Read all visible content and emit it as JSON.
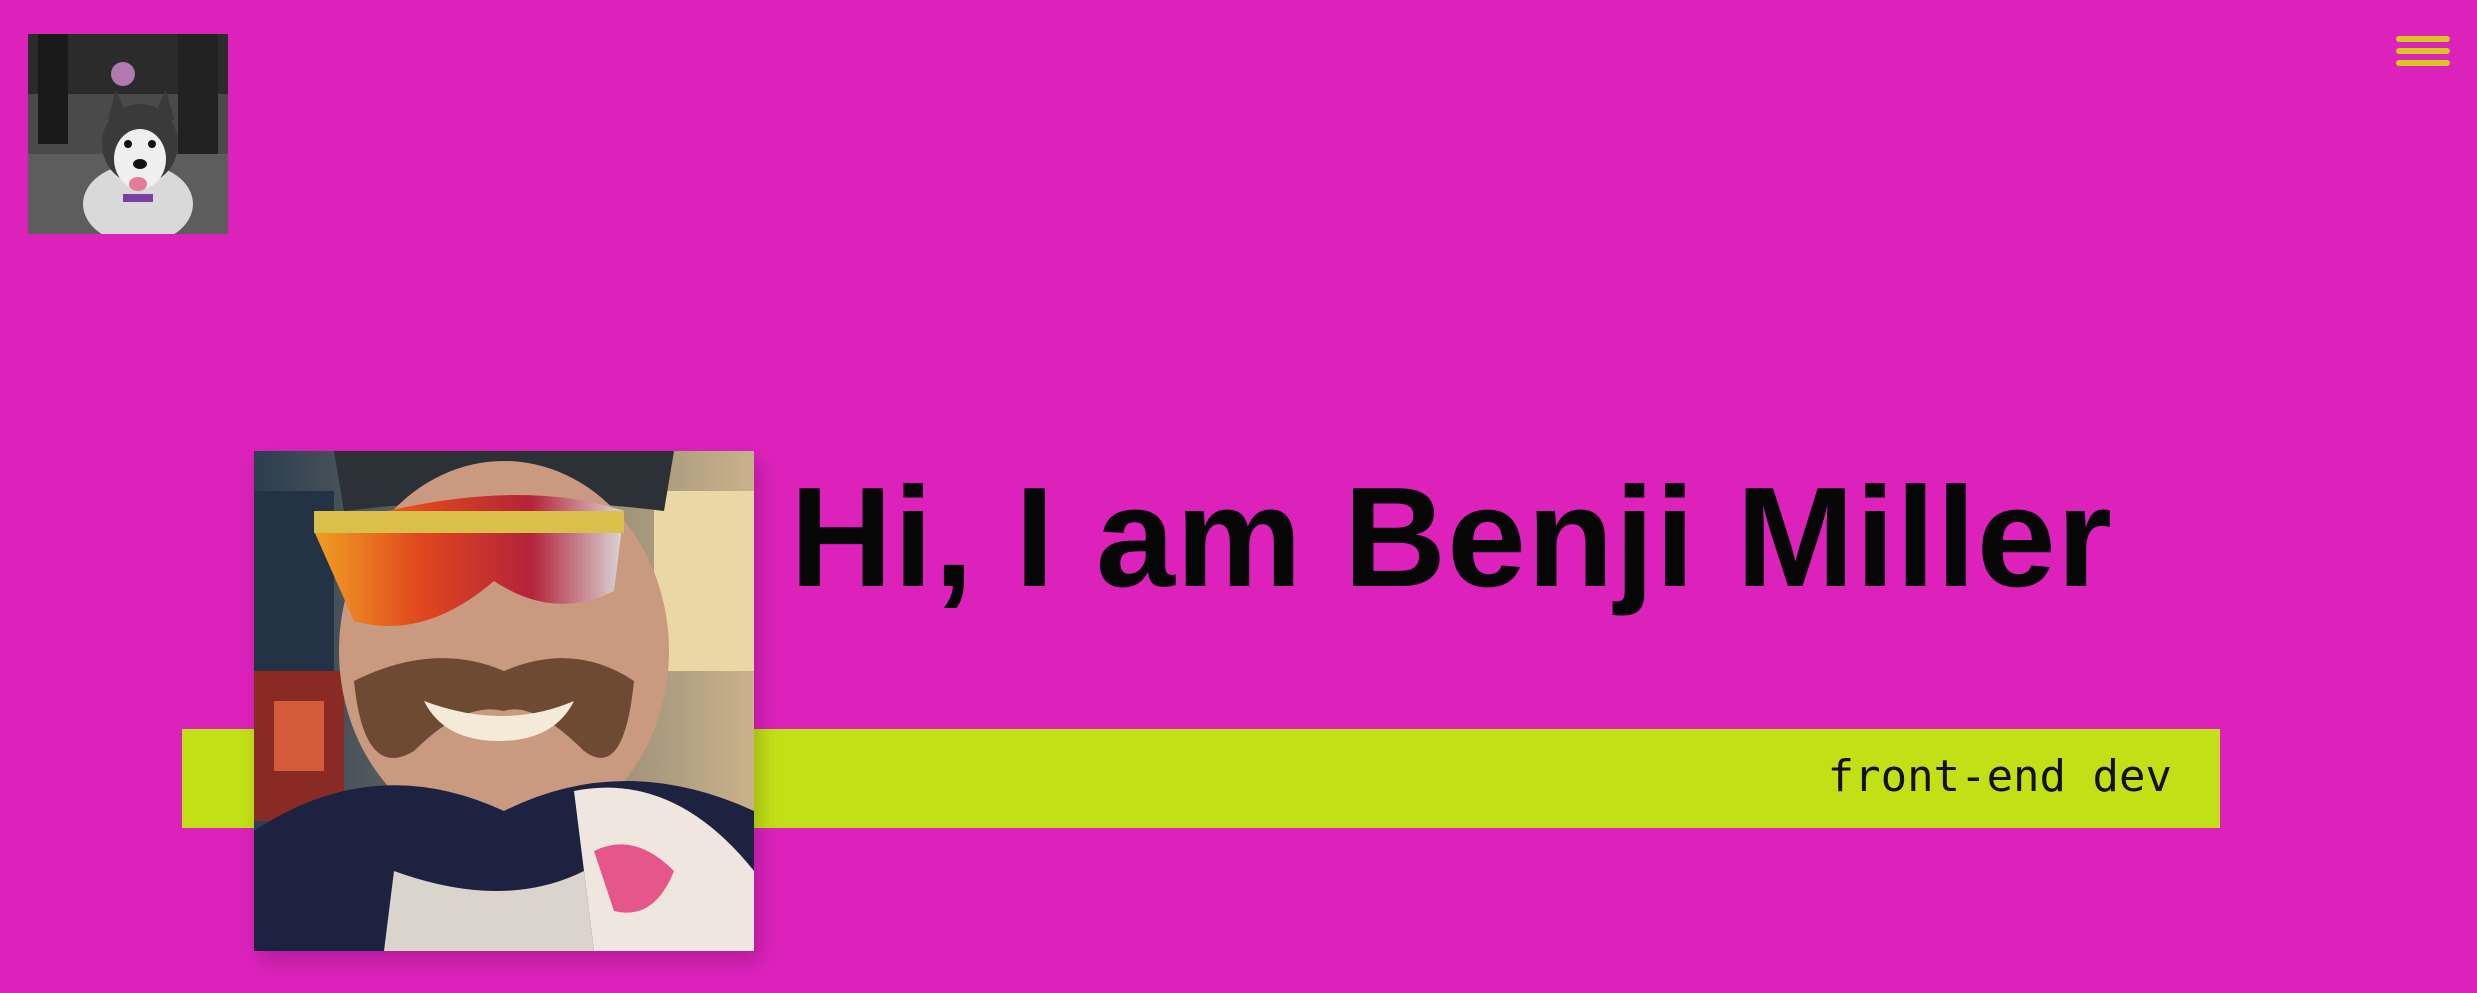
{
  "header": {
    "avatar_alt": "husky dog",
    "menu_icon": "hamburger-menu-icon",
    "menu_color": "#d7c624"
  },
  "hero": {
    "greeting": "Hi, I am",
    "name": "Benji Miller",
    "tagline": "front-end dev",
    "portrait_alt": "Benji Miller wearing reflective sunglasses"
  },
  "colors": {
    "background": "#dc22bb",
    "strip": "#c1e016",
    "text": "#060606"
  }
}
